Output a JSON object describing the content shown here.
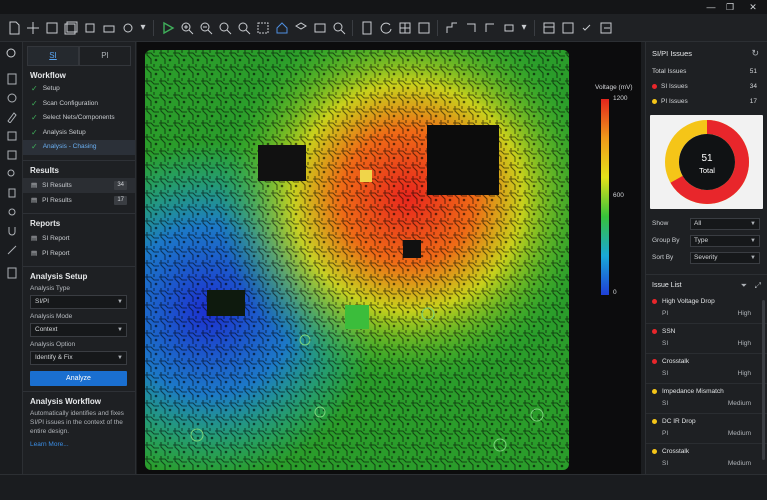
{
  "window": {
    "minimize": "—",
    "restore": "❐",
    "close": "✕"
  },
  "left_panel": {
    "tabs": [
      {
        "label": "SI",
        "active": true
      },
      {
        "label": "PI",
        "active": false
      }
    ],
    "workflow_title": "Workflow",
    "workflow": [
      "Setup",
      "Scan Configuration",
      "Select Nets/Components",
      "Analysis Setup",
      "Analysis - Chasing"
    ],
    "results_title": "Results",
    "results": [
      {
        "label": "SI Results",
        "count": "34"
      },
      {
        "label": "PI Results",
        "count": "17"
      }
    ],
    "reports_title": "Reports",
    "reports": [
      "SI Report",
      "PI Report"
    ],
    "setup_title": "Analysis Setup",
    "analysis_type_label": "Analysis Type",
    "analysis_type": "SI/PI",
    "analysis_mode_label": "Analysis Mode",
    "analysis_mode": "Context",
    "analysis_option_label": "Analysis Option",
    "analysis_option": "Identify & Fix",
    "analyze_button": "Analyze",
    "aw_title": "Analysis Workflow",
    "aw_desc": "Automatically identifies and fixes SI/PI issues in the context of the entire design.",
    "learn_more": "Learn More..."
  },
  "legend": {
    "title": "Voltage (mV)",
    "max": "1200",
    "mid": "600",
    "min": "0"
  },
  "right_panel": {
    "title": "SI/PI Issues",
    "total_label": "Total Issues",
    "total": "51",
    "si_label": "SI Issues",
    "si": "34",
    "pi_label": "PI Issues",
    "pi": "17",
    "donut_value": "51",
    "donut_label": "Total",
    "colors": {
      "si": "#e8262b",
      "pi": "#f5c518"
    },
    "show_label": "Show",
    "show": "All",
    "group_label": "Group By",
    "group": "Type",
    "sort_label": "Sort By",
    "sort": "Severity",
    "issue_list_title": "Issue List",
    "issues": [
      {
        "title": "High Voltage Drop",
        "type": "PI",
        "severity": "High",
        "color": "#e8262b"
      },
      {
        "title": "SSN",
        "type": "SI",
        "severity": "High",
        "color": "#e8262b"
      },
      {
        "title": "Crosstalk",
        "type": "SI",
        "severity": "High",
        "color": "#e8262b"
      },
      {
        "title": "Impedance Mismatch",
        "type": "SI",
        "severity": "Medium",
        "color": "#f5c518"
      },
      {
        "title": "DC IR Drop",
        "type": "PI",
        "severity": "Medium",
        "color": "#f5c518"
      },
      {
        "title": "Crosstalk",
        "type": "SI",
        "severity": "Medium",
        "color": "#f5c518"
      }
    ]
  }
}
